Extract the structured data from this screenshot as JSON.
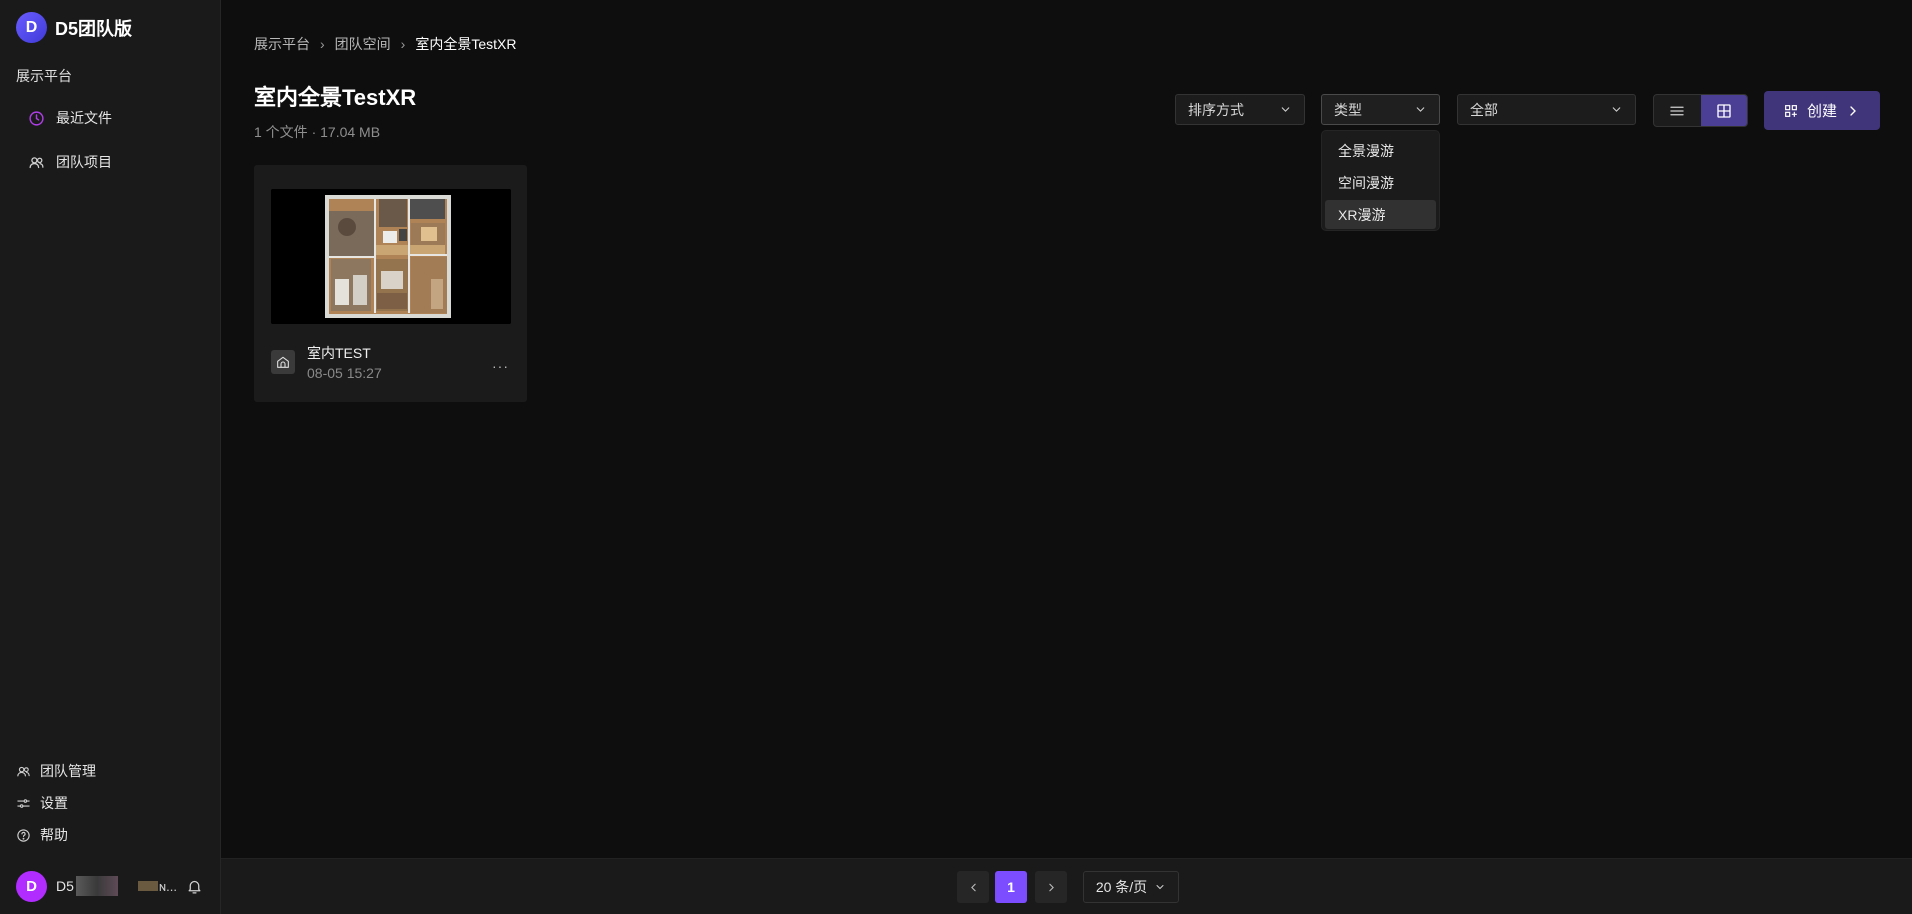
{
  "brand": {
    "logo_letter": "D",
    "name": "D5团队版"
  },
  "sidebar": {
    "section_title": "展示平台",
    "nav": [
      {
        "label": "最近文件",
        "icon": "clock-icon"
      },
      {
        "label": "团队项目",
        "icon": "users-icon"
      }
    ],
    "bottom": [
      {
        "label": "团队管理",
        "icon": "users-icon"
      },
      {
        "label": "设置",
        "icon": "sliders-icon"
      },
      {
        "label": "帮助",
        "icon": "help-circle-icon"
      }
    ],
    "user": {
      "avatar_letter": "D",
      "name": "D5",
      "truncated": "ɴ..."
    }
  },
  "breadcrumb": {
    "items": [
      "展示平台",
      "团队空间"
    ],
    "current": "室内全景TestXR"
  },
  "page": {
    "title": "室内全景TestXR",
    "meta": "1 个文件 · 17.04 MB"
  },
  "toolbar": {
    "sort_label": "排序方式",
    "type_label": "类型",
    "filter_label": "全部",
    "create_label": "创建"
  },
  "type_dropdown": {
    "options": [
      "全景漫游",
      "空间漫游",
      "XR漫游"
    ],
    "selected": "XR漫游"
  },
  "files": [
    {
      "title": "室内TEST",
      "date": "08-05 15:27",
      "more": "···"
    }
  ],
  "pagination": {
    "current_page": "1",
    "page_size": "20 条/页"
  },
  "colors": {
    "accent": "#7c4dff",
    "create_button": "#40357a",
    "avatar_brand": "#4a43e0",
    "avatar_user": "#b02cff"
  }
}
